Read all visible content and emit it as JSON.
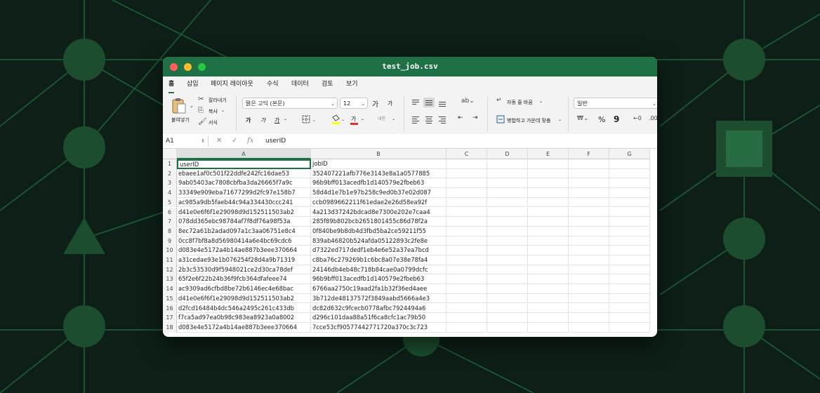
{
  "window": {
    "title": "test_job.csv"
  },
  "menu": [
    "홈",
    "삽입",
    "페이지 레이아웃",
    "수식",
    "데이터",
    "검토",
    "보기"
  ],
  "ribbon": {
    "paste_label": "붙여넣기",
    "cut_label": "잘라내기",
    "copy_label": "복사",
    "format_label": "서식",
    "font_name": "맑은 고딕 (본문)",
    "font_size": "12",
    "grow_font": "가",
    "shrink_font": "가",
    "bold": "가",
    "italic": "가",
    "underline": "가",
    "font_color_glyph": "가",
    "phonetic": "내천",
    "wrap_text_label": "자동 줄 바꿈",
    "merge_center_label": "병합하고 가운데 맞춤",
    "number_format": "일반",
    "percent": "%",
    "comma": "9"
  },
  "formula_bar": {
    "cell_ref": "A1",
    "fx": "fx",
    "content": "userID"
  },
  "sheet": {
    "columns": [
      "A",
      "B",
      "C",
      "D",
      "E",
      "F",
      "G"
    ],
    "rows": [
      [
        "userID",
        "jobID"
      ],
      [
        "ebaee1af0c501f22ddfe242fc16dae53",
        "352407221afb776e3143e8a1a0577885"
      ],
      [
        "9ab05403ac7808cbfba3da26665f7a9c",
        "96b9bff013acedfb1d140579e2fbeb63"
      ],
      [
        "33349e909eba71677299d2fc97e158b7",
        "58d4d1e7b1e97b258c9ed0b37e02d087"
      ],
      [
        "ac985a9db5faeb44c94a334430ccc241",
        "ccb0989662211f61edae2e26d58ea92f"
      ],
      [
        "d41e0e6f6f1e29098d9d152511503ab2",
        "4a213d37242bdcad8e7300e202e7caa4"
      ],
      [
        "078dd365ebc98784af7f8df76a98f53a",
        "285f89b802bcb2651801455c86d78f2a"
      ],
      [
        "8ec72a61b2adad097a1c3aa06751e8c4",
        "0f840be9b8db4d3fbd5ba2ce59211f55"
      ],
      [
        "0cc8f7bf8a8d56980414a6e4bc69cdc6",
        "839ab46820b524afda05122893c2fe8e"
      ],
      [
        "d083e4e5172a4b14ae887b3eee370664",
        "d7322ed717dedf1eb4e6e52a37ea7bcd"
      ],
      [
        "a31cedae93e1b076254f28d4a9b71319",
        "c8ba76c279269b1c6bc8a07e38e78fa4"
      ],
      [
        "2b3c53530d9f5948021ce2d30ca78def",
        "24146db4eb48c718b84cae0a0799dcfc"
      ],
      [
        "65f2e6f22b24b36f9fcb364dfafeee74",
        "96b9bff013acedfb1d140579e2fbeb63"
      ],
      [
        "ac9309ad6cfbd8be72b6146ec4e68bac",
        "6766aa2750c19aad2fa1b32f36ed4aee"
      ],
      [
        "d41e0e6f6f1e29098d9d152511503ab2",
        "3b712de48137572f3849aabd5666a4e3"
      ],
      [
        "d2fcd16484b4dc546a2495c261c433db",
        "dc82d632c9fcecb0778afbc7924494a6"
      ],
      [
        "f7ca5ad97ea0b98c983ea8923a0a8002",
        "d296c101daa88a51f6ca8cfc1ac79b50"
      ],
      [
        "d083e4e5172a4b14ae887b3eee370664",
        "7cce53cf90577442771720a370c3c723"
      ]
    ]
  },
  "colors": {
    "accent": "#1e7145",
    "background": "#0d1f17",
    "network": "#1b4d2e"
  }
}
